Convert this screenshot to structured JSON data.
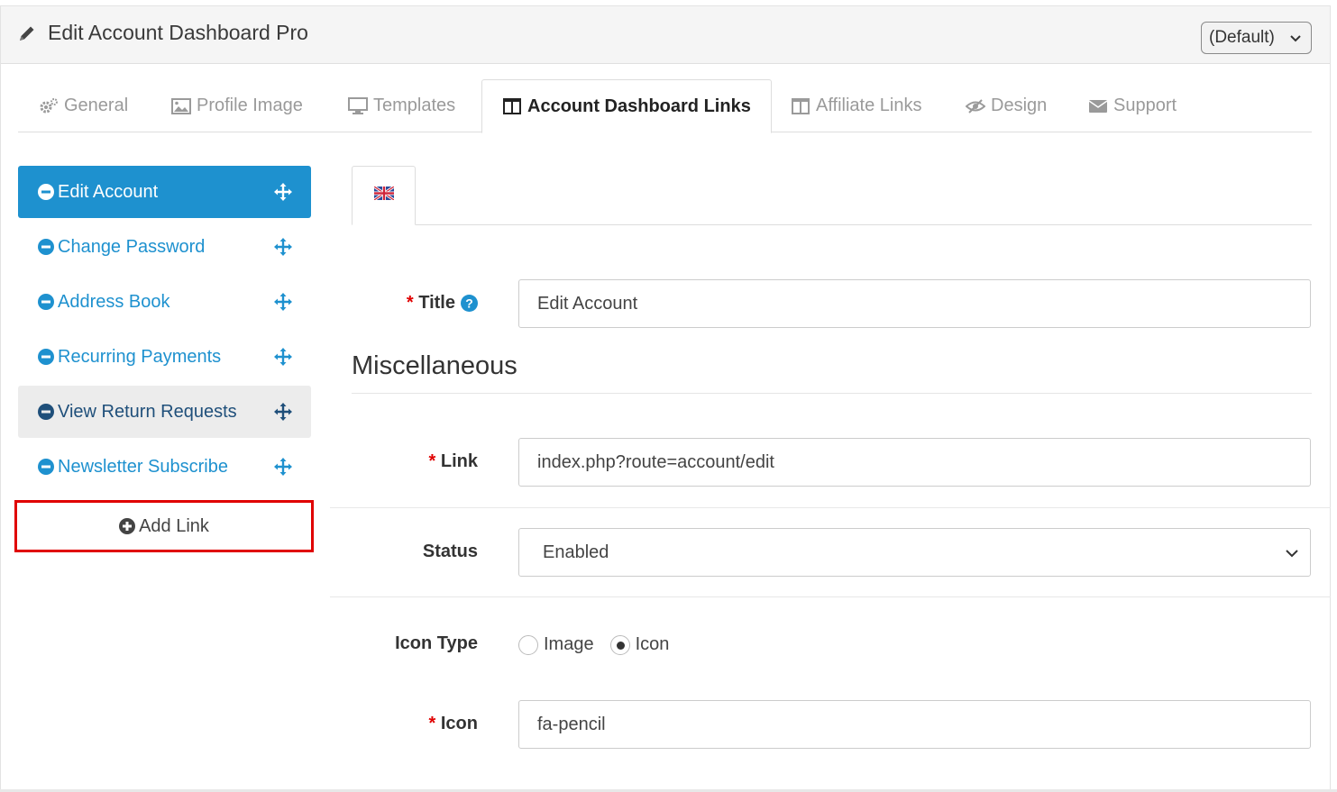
{
  "header": {
    "title": "Edit Account Dashboard Pro",
    "store_select": "(Default)"
  },
  "tabs": [
    {
      "label": "General",
      "icon": "cogs-icon"
    },
    {
      "label": "Profile Image",
      "icon": "image-icon"
    },
    {
      "label": "Templates",
      "icon": "desktop-icon"
    },
    {
      "label": "Account Dashboard Links",
      "icon": "columns-icon",
      "active": true
    },
    {
      "label": "Affiliate Links",
      "icon": "columns-icon"
    },
    {
      "label": "Design",
      "icon": "eye-slash-icon"
    },
    {
      "label": "Support",
      "icon": "envelope-icon"
    }
  ],
  "sidebar": {
    "items": [
      {
        "label": "Edit Account"
      },
      {
        "label": "Change Password"
      },
      {
        "label": "Address Book"
      },
      {
        "label": "Recurring Payments"
      },
      {
        "label": "View Return Requests"
      },
      {
        "label": "Newsletter Subscribe"
      }
    ],
    "add_link": "Add Link"
  },
  "language_tab": {
    "icon": "uk-flag-icon"
  },
  "form": {
    "title_label": "Title",
    "title_value": "Edit Account",
    "misc_legend": "Miscellaneous",
    "link_label": "Link",
    "link_value": "index.php?route=account/edit",
    "status_label": "Status",
    "status_value": "Enabled",
    "icon_type_label": "Icon Type",
    "icon_type_options": [
      "Image",
      "Icon"
    ],
    "icon_type_selected": "Icon",
    "icon_label": "Icon",
    "icon_value": "fa-pencil",
    "required_mark": "*"
  },
  "colors": {
    "accent": "#1e91cf",
    "required": "#e00000",
    "highlight_border": "#e00000"
  }
}
